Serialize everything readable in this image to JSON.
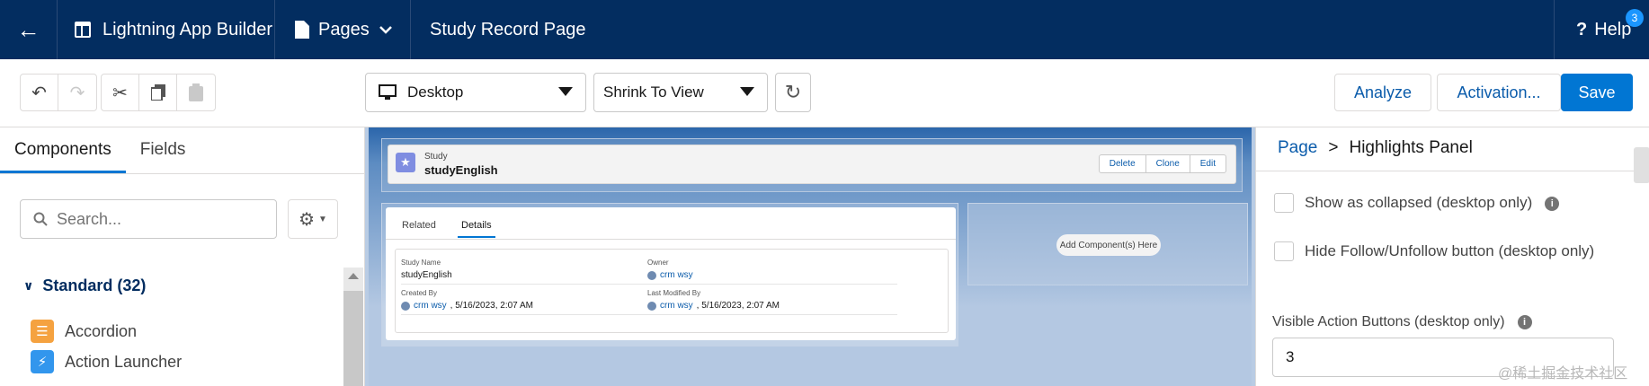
{
  "topbar": {
    "app_name": "Lightning App Builder",
    "pages_label": "Pages",
    "page_title": "Study Record Page",
    "help_label": "Help",
    "help_badge": "3"
  },
  "toolbar": {
    "device_select": "Desktop",
    "view_select": "Shrink To View",
    "analyze_label": "Analyze",
    "activation_label": "Activation...",
    "save_label": "Save"
  },
  "left_panel": {
    "tabs": [
      "Components",
      "Fields"
    ],
    "search_placeholder": "Search...",
    "section_title": "Standard (32)",
    "components": [
      {
        "label": "Accordion",
        "icon": "accordion-icon",
        "color": "#f5a240"
      },
      {
        "label": "Action Launcher",
        "icon": "lightning-icon",
        "color": "#3296ed"
      }
    ]
  },
  "canvas": {
    "highlights": {
      "object_label": "Study",
      "record_name": "studyEnglish",
      "actions": [
        "Delete",
        "Clone",
        "Edit"
      ]
    },
    "details": {
      "tabs": [
        "Related",
        "Details"
      ],
      "fields": [
        {
          "label": "Study Name",
          "value": "studyEnglish",
          "link": "",
          "date": ""
        },
        {
          "label": "Owner",
          "value": "",
          "link": "crm wsy",
          "date": ""
        },
        {
          "label": "Created By",
          "value": "",
          "link": "crm wsy",
          "date": ", 5/16/2023, 2:07 AM"
        },
        {
          "label": "Last Modified By",
          "value": "",
          "link": "crm wsy",
          "date": ", 5/16/2023, 2:07 AM"
        }
      ]
    },
    "add_component_label": "Add Component(s) Here"
  },
  "right_panel": {
    "breadcrumb_root": "Page",
    "breadcrumb_sep": ">",
    "breadcrumb_current": "Highlights Panel",
    "option_collapsed": "Show as collapsed (desktop only)",
    "option_follow": "Hide Follow/Unfollow button (desktop only)",
    "visible_actions_label": "Visible Action Buttons (desktop only)",
    "visible_actions_value": "3"
  },
  "watermark": "@稀土掘金技术社区",
  "colors": {
    "nav_bg": "#032d60",
    "brand_blue": "#0176d3",
    "link_blue": "#0b5cab"
  }
}
